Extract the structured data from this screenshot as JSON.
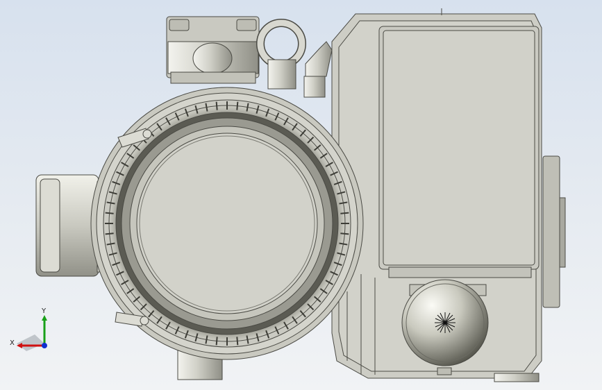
{
  "viewport": {
    "background_top": "#d7e1ee",
    "background_bottom": "#f1f3f5",
    "model": "vacuum-pump-assembly"
  },
  "triad": {
    "x_label": "X",
    "y_label": "Y",
    "x_color": "#d01010",
    "y_color": "#18a018",
    "z_color": "#1030d0"
  },
  "colors": {
    "metal_light": "#e4e4dc",
    "metal_mid": "#c7c7be",
    "metal_dark": "#9a9a90",
    "edge": "#4a4a44"
  }
}
